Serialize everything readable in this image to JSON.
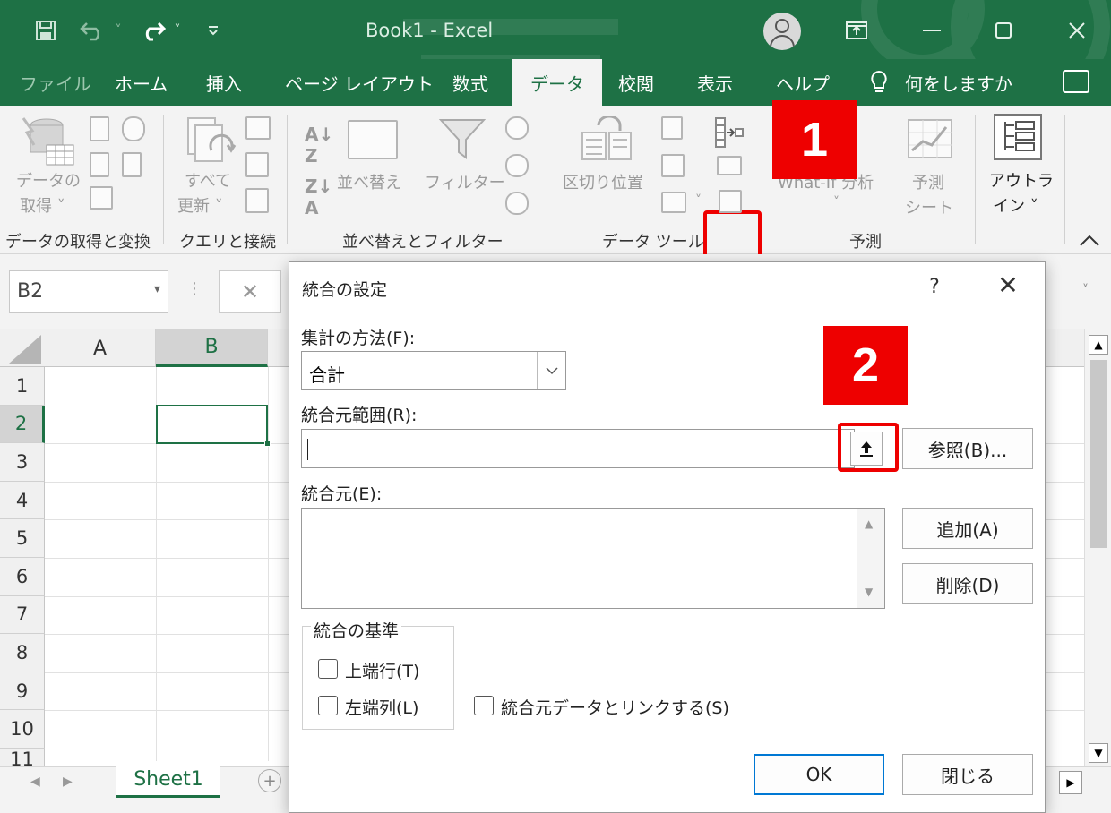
{
  "window": {
    "title": "Book1  -  Excel",
    "minimize_icon": "minimize-icon",
    "restore_icon": "restore-icon",
    "close_icon": "close-icon"
  },
  "quick_access": {
    "icons": [
      "save-icon",
      "undo-icon",
      "redo-icon",
      "customize-icon"
    ]
  },
  "tabs": [
    {
      "label": "ファイル",
      "dim": true
    },
    {
      "label": "ホーム"
    },
    {
      "label": "挿入"
    },
    {
      "label": "ページ レイアウト"
    },
    {
      "label": "数式"
    },
    {
      "label": "データ",
      "active": true
    },
    {
      "label": "校閲"
    },
    {
      "label": "表示"
    },
    {
      "label": "ヘルプ"
    }
  ],
  "tell_me": "何をしますか",
  "ribbon": {
    "get_data": [
      "データの",
      "取得 ˅"
    ],
    "refresh_all": [
      "すべて",
      "更新 ˅"
    ],
    "sort": "並べ替え",
    "filter": "フィルター",
    "text_to_columns": "区切り位置",
    "what_if": "What-If 分析",
    "what_if_arrow": "˅",
    "forecast_sheet": [
      "予測",
      "シート"
    ],
    "outline": [
      "アウトラ",
      "イン ˅"
    ],
    "groups": {
      "get_transform": "データの取得と変換",
      "queries": "クエリと接続",
      "sort_filter": "並べ替えとフィルター",
      "data_tools": "データ ツール",
      "forecast": "予測"
    }
  },
  "formula_bar": {
    "name_box": "B2"
  },
  "grid": {
    "columns": [
      "A",
      "B"
    ],
    "rows": [
      "1",
      "2",
      "3",
      "4",
      "5",
      "6",
      "7",
      "8",
      "9",
      "10",
      "11"
    ],
    "selected_column": "B",
    "selected_row": "2",
    "sheet_tab": "Sheet1"
  },
  "dialog": {
    "title": "統合の設定",
    "help": "?",
    "close": "✕",
    "function_label": "集計の方法(F):",
    "function_value": "合計",
    "reference_label": "統合元範囲(R):",
    "reference_value": "",
    "browse_button": "参照(B)...",
    "sources_label": "統合元(E):",
    "add_button": "追加(A)",
    "delete_button": "削除(D)",
    "basis_group_label": "統合の基準",
    "top_row_label": "上端行(T)",
    "left_column_label": "左端列(L)",
    "link_label": "統合元データとリンクする(S)",
    "ok_button": "OK",
    "close_button": "閉じる"
  },
  "annotations": {
    "badge1": "1",
    "badge2": "2",
    "color": "#e60000"
  },
  "colors": {
    "excel_green": "#1e7145",
    "ribbon_bg": "#f3f3f3"
  }
}
